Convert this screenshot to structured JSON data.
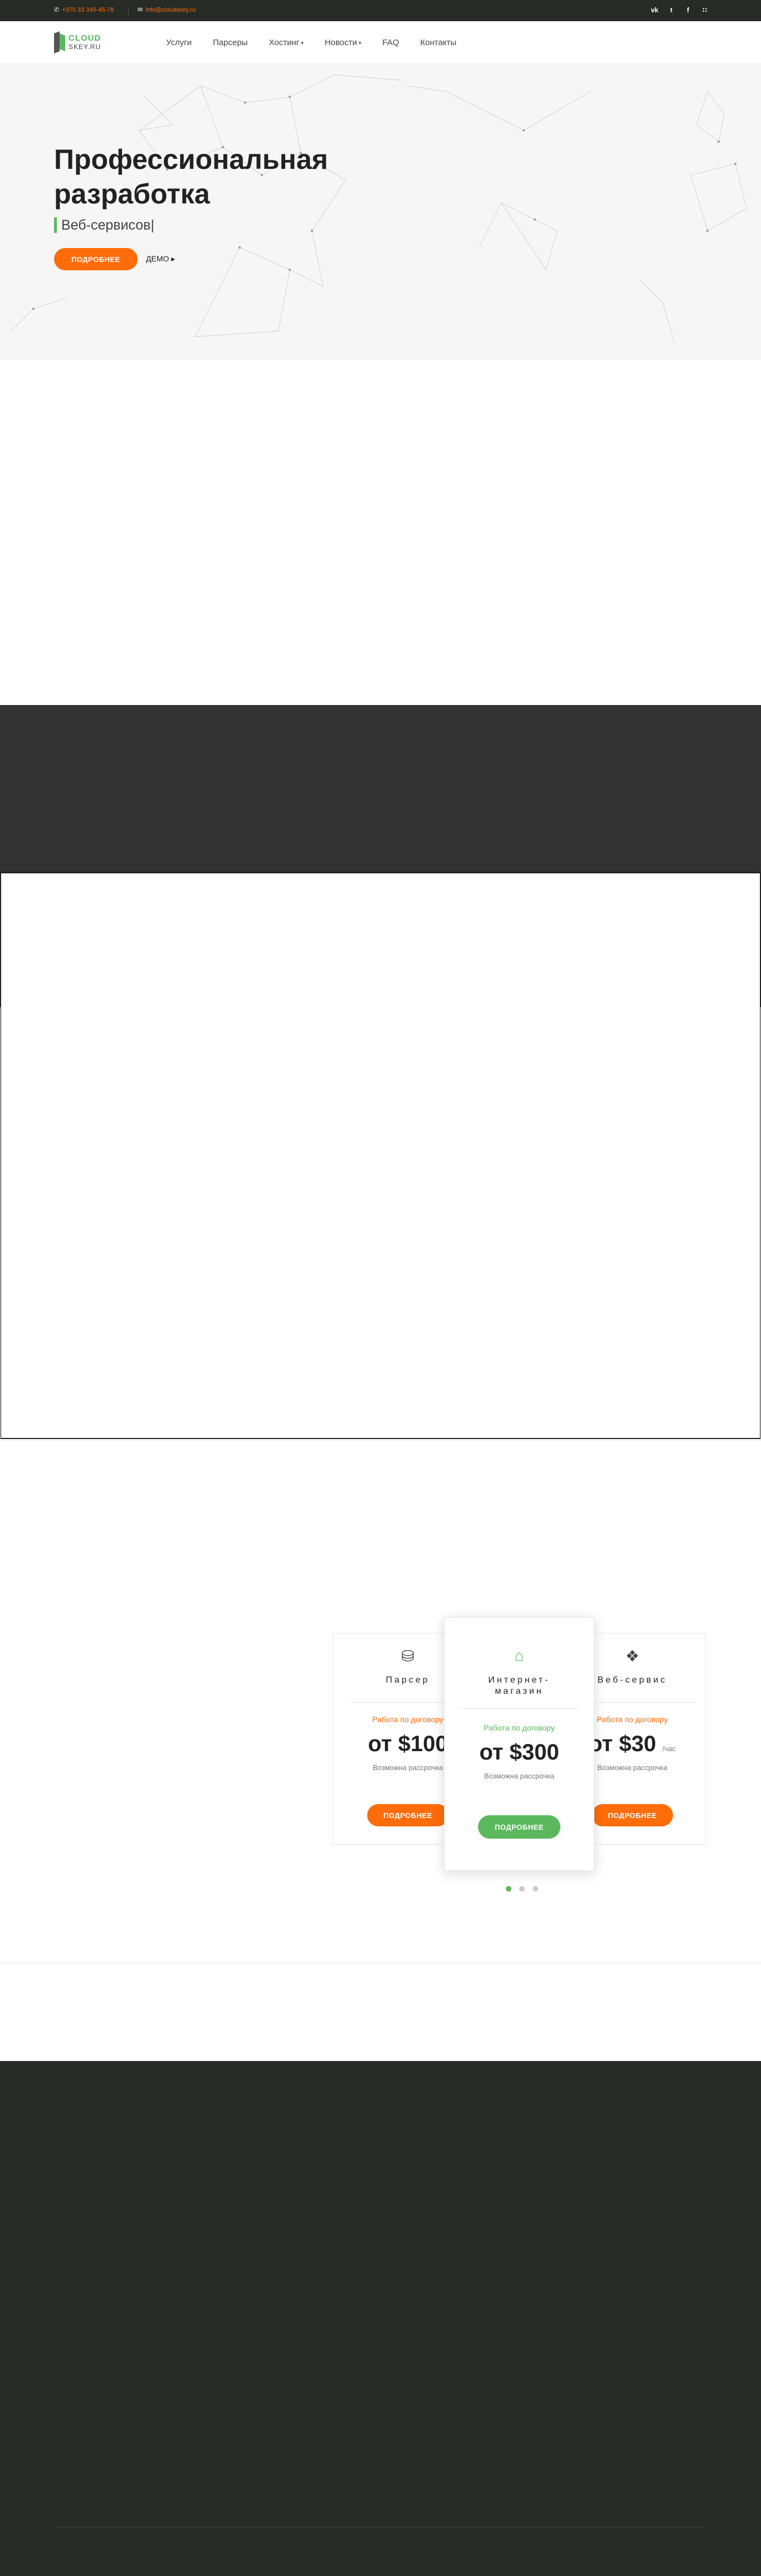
{
  "topbar": {
    "phone_icon": "phone-icon",
    "phone": "+375 33 345-45-78",
    "email_icon": "envelope-icon",
    "email": "info@cloudskey.ru",
    "social": [
      {
        "icon": "vk-icon",
        "glyph": "vk"
      },
      {
        "icon": "twitter-icon",
        "glyph": "t"
      },
      {
        "icon": "facebook-icon",
        "glyph": "f"
      },
      {
        "icon": "rss-icon",
        "glyph": "∷"
      }
    ]
  },
  "logo": {
    "line1": "CLOUD",
    "line2": "SKEY.RU"
  },
  "nav": {
    "items": [
      {
        "label": "Услуги",
        "dropdown": false
      },
      {
        "label": "Парсеры",
        "dropdown": false
      },
      {
        "label": "Хостинг",
        "dropdown": true
      },
      {
        "label": "Новости",
        "dropdown": true
      },
      {
        "label": "FAQ",
        "dropdown": false
      },
      {
        "label": "Контакты",
        "dropdown": false
      }
    ],
    "caret": "▾"
  },
  "hero": {
    "title": "Профессиональная разработка",
    "subtitle": "Веб-сервисов",
    "cursor": "|",
    "more_button": "ПОДРОБНЕЕ",
    "demo_link": "ДЕМО",
    "demo_arrow": "▸"
  },
  "pricing": {
    "cards": [
      {
        "icon": "database-icon",
        "glyph": "⛁",
        "name": "Парсер",
        "terms": "Работа по договору",
        "price": "от $100",
        "unit": "",
        "note": "Возможна рассрочка",
        "button": "ПОДРОБНЕЕ"
      },
      {
        "icon": "basket-icon",
        "glyph": "⌂",
        "name": "Интернет-магазин",
        "terms": "Работа по договору",
        "price": "от $300",
        "unit": "",
        "note": "Возможна рассрочка",
        "button": "ПОДРОБНЕЕ"
      },
      {
        "icon": "cubes-icon",
        "glyph": "❖",
        "name": "Веб-сервис",
        "terms": "Работа по договору",
        "price": "от $30",
        "unit": "/час",
        "note": "Возможна рассрочка",
        "button": "ПОДРОБНЕЕ"
      }
    ],
    "active_slide": 1,
    "slide_count": 3
  },
  "colors": {
    "accent_orange": "#ff6c0a",
    "accent_green": "#5cb85c",
    "dark": "#272b25"
  }
}
